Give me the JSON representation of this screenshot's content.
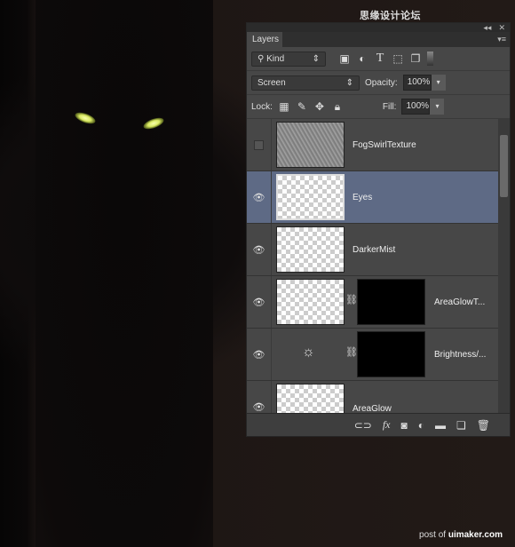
{
  "watermark": "思缘设计论坛 WWW.MISSYUAN.COM",
  "credit": {
    "prefix": "post of",
    "site": "uimaker.com"
  },
  "panel": {
    "title": "Layers",
    "filter": {
      "kind": "Kind"
    },
    "blend_mode": "Screen",
    "opacity_label": "Opacity:",
    "opacity": "100%",
    "lock_label": "Lock:",
    "fill_label": "Fill:",
    "fill": "100%",
    "layers": [
      {
        "name": "FogSwirlTexture",
        "visible": false,
        "selected": false
      },
      {
        "name": "Eyes",
        "visible": true,
        "selected": true
      },
      {
        "name": "DarkerMist",
        "visible": true,
        "selected": false
      },
      {
        "name": "AreaGlowT...",
        "visible": true,
        "selected": false,
        "mask": true
      },
      {
        "name": "Brightness/...",
        "visible": true,
        "selected": false,
        "mask": true,
        "adjustment": "brightness-contrast"
      },
      {
        "name": "AreaGlow",
        "visible": true,
        "selected": false
      }
    ]
  }
}
